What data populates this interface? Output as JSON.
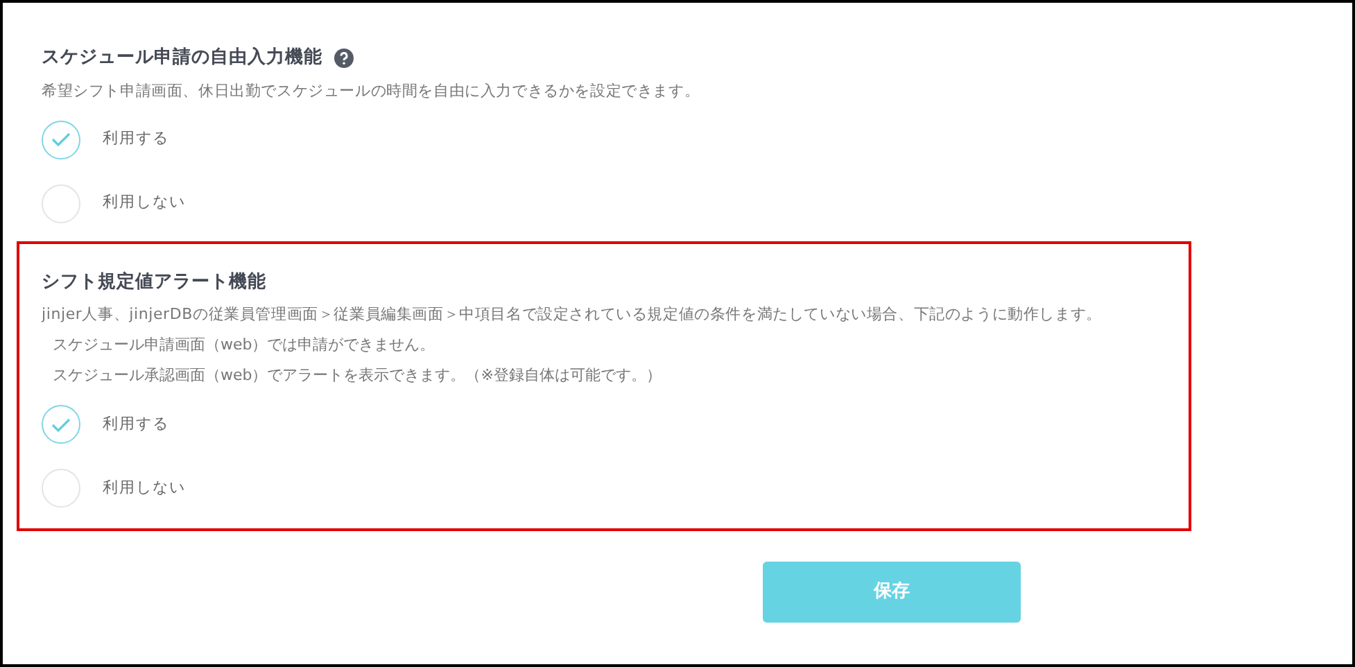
{
  "sections": [
    {
      "title": "スケジュール申請の自由入力機能",
      "has_help": true,
      "highlighted": false,
      "description": "希望シフト申請画面、休日出勤でスケジュールの時間を自由に入力できるかを設定できます。",
      "options": [
        {
          "label": "利用する",
          "selected": true
        },
        {
          "label": "利用しない",
          "selected": false
        }
      ]
    },
    {
      "title": "シフト規定値アラート機能",
      "has_help": false,
      "highlighted": true,
      "description": "jinjer人事、jinjerDBの従業員管理画面＞従業員編集画面＞中項目名で設定されている規定値の条件を満たしていない場合、下記のように動作します。",
      "notes": [
        "スケジュール申請画面（web）では申請ができません。",
        "スケジュール承認画面（web）でアラートを表示できます。（※登録自体は可能です。）"
      ],
      "options": [
        {
          "label": "利用する",
          "selected": true
        },
        {
          "label": "利用しない",
          "selected": false
        }
      ]
    }
  ],
  "save_button": "保存"
}
